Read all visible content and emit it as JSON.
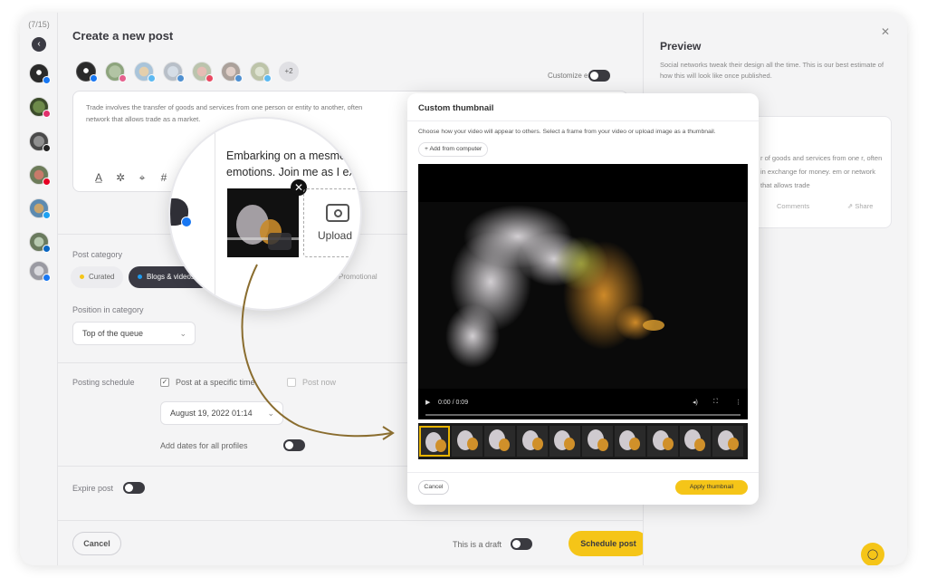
{
  "rail": {
    "counter": "(7/15)"
  },
  "composer": {
    "title": "Create a new post",
    "extra_profiles": "+2",
    "customize_label": "Customize each",
    "body_text": "Trade involves the transfer of goods and services from one person or entity to another, often in exchange for money. A system or network that allows trade is called a market.",
    "body_text_visible": "Trade involves the transfer of goods and services from one person or entity to another, often",
    "body_text_visible2": "network that allows trade as a market.",
    "post_category_label": "Post category",
    "category_chips": [
      "Curated",
      "Blogs & videos",
      "Promotional"
    ],
    "position_label": "Position in category",
    "position_value": "Top of the queue",
    "schedule_label": "Posting schedule",
    "specific_time_label": "Post at a specific time",
    "post_now_label": "Post now",
    "schedule_date": "August 19, 2022 01:14",
    "add_dates_label": "Add dates for all profiles",
    "expire_label": "Expire post",
    "cancel_label": "Cancel",
    "draft_label": "This is a draft",
    "schedule_button": "Schedule post"
  },
  "preview": {
    "title": "Preview",
    "subtitle": "Social networks tweak their design all the time. This is our best estimate of how this will look like once published.",
    "card_text": "r of goods and services from one r, often in exchange for money. em or network that allows trade",
    "comments": "Comments",
    "share": "Share"
  },
  "thumbnail_modal": {
    "title": "Custom thumbnail",
    "description": "Choose how your video will appear to others. Select a frame from your video or upload image as a thumbnail.",
    "add_from_computer": "Add from computer",
    "time": "0:00 / 0:09",
    "cancel": "Cancel",
    "apply": "Apply thumbnail"
  },
  "magnifier": {
    "text_line1": "Embarking on a mesme",
    "text_line2": "emotions. Join me as I exp",
    "upload_label": "Upload"
  },
  "colors": {
    "accent": "#f5c518",
    "chip_active": "#3a3a44",
    "facebook": "#1877f2",
    "instagram": "#e1306c",
    "linkedin": "#0a66c2",
    "twitter": "#1da1f2",
    "pinterest": "#e60023",
    "arrow": "#8a6d2f"
  }
}
